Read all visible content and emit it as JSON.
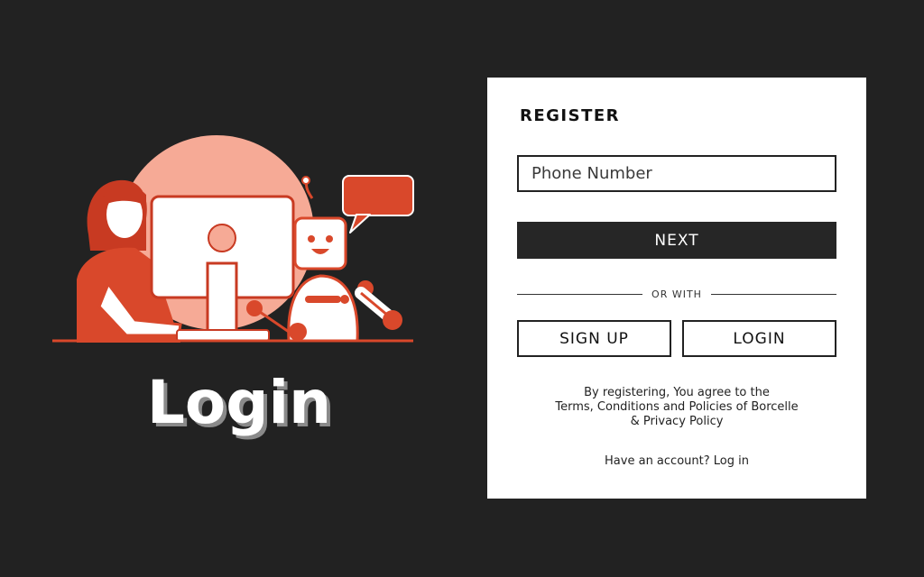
{
  "hero": {
    "title": "Login"
  },
  "register": {
    "title": "REGISTER",
    "phone_placeholder": "Phone Number",
    "next_label": "NEXT",
    "divider_text": "OR WITH",
    "signup_label": "SIGN UP",
    "login_label": "LOGIN",
    "terms_lines": [
      "By registering, You agree to the",
      "Terms, Conditions and Policies of Borcelle",
      "& Privacy Policy"
    ],
    "have_account": "Have an account? Log in"
  },
  "colors": {
    "background": "#222222",
    "accent": "#d9482b",
    "accent_light": "#f6aa96",
    "card": "#ffffff"
  }
}
